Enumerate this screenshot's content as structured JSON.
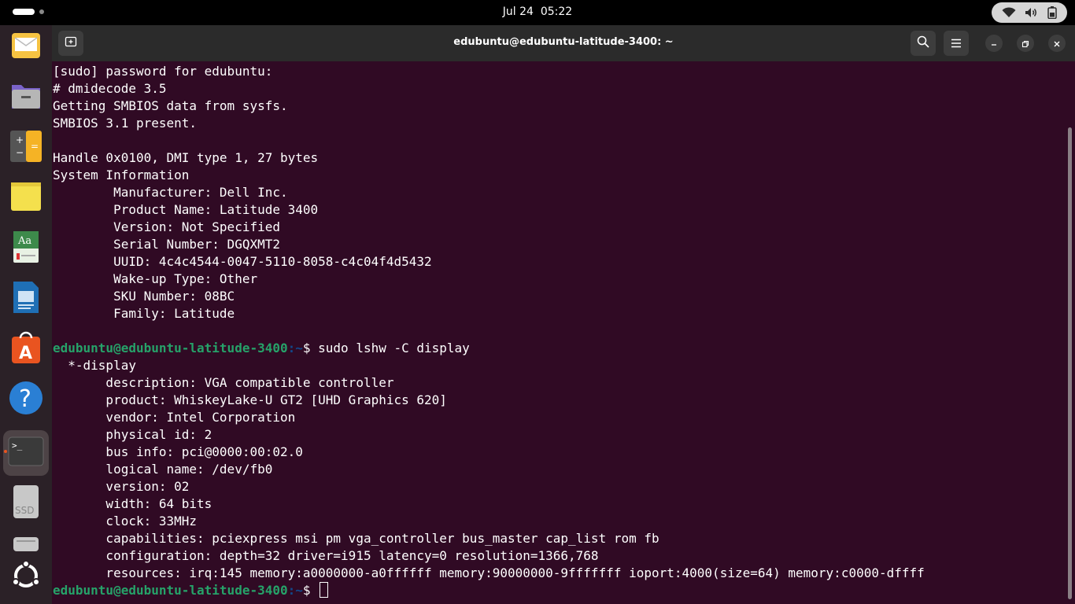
{
  "topbar": {
    "clock_date": "Jul 24",
    "clock_time": "05:22"
  },
  "systray": {
    "icons": [
      "wifi-icon",
      "volume-icon",
      "battery-icon"
    ]
  },
  "dock": {
    "items": [
      {
        "name": "mail-app",
        "icon": "envelope"
      },
      {
        "name": "files-app",
        "icon": "folder"
      },
      {
        "name": "calculator-app",
        "icon": "calculator"
      },
      {
        "name": "notes-app",
        "icon": "sticky-note"
      },
      {
        "name": "dictionary-app",
        "icon": "book-aa"
      },
      {
        "name": "writer-app",
        "icon": "document"
      },
      {
        "name": "app-center",
        "icon": "store-a"
      },
      {
        "name": "help-app",
        "icon": "question-mark"
      },
      {
        "name": "terminal-app",
        "icon": "terminal",
        "active": true
      },
      {
        "name": "ssd-drive",
        "icon": "drive",
        "label": "SSD"
      },
      {
        "name": "drive",
        "icon": "drive"
      },
      {
        "name": "show-apps",
        "icon": "ubuntu-logo"
      }
    ]
  },
  "window": {
    "title": "edubuntu@edubuntu-latitude-3400: ~"
  },
  "terminal": {
    "lines": [
      {
        "text": "[sudo] password for edubuntu:"
      },
      {
        "text": "# dmidecode 3.5"
      },
      {
        "text": "Getting SMBIOS data from sysfs."
      },
      {
        "text": "SMBIOS 3.1 present."
      },
      {
        "text": ""
      },
      {
        "text": "Handle 0x0100, DMI type 1, 27 bytes"
      },
      {
        "text": "System Information"
      },
      {
        "text": "        Manufacturer: Dell Inc."
      },
      {
        "text": "        Product Name: Latitude 3400"
      },
      {
        "text": "        Version: Not Specified"
      },
      {
        "text": "        Serial Number: DGQXMT2"
      },
      {
        "text": "        UUID: 4c4c4544-0047-5110-8058-c4c04f4d5432"
      },
      {
        "text": "        Wake-up Type: Other"
      },
      {
        "text": "        SKU Number: 08BC"
      },
      {
        "text": "        Family: Latitude"
      },
      {
        "text": ""
      },
      {
        "prompt": {
          "user": "edubuntu@edubuntu-latitude-3400",
          "path": ":~",
          "symbol": "$ "
        },
        "text": "sudo lshw -C display"
      },
      {
        "text": "  *-display"
      },
      {
        "text": "       description: VGA compatible controller"
      },
      {
        "text": "       product: WhiskeyLake-U GT2 [UHD Graphics 620]"
      },
      {
        "text": "       vendor: Intel Corporation"
      },
      {
        "text": "       physical id: 2"
      },
      {
        "text": "       bus info: pci@0000:00:02.0"
      },
      {
        "text": "       logical name: /dev/fb0"
      },
      {
        "text": "       version: 02"
      },
      {
        "text": "       width: 64 bits"
      },
      {
        "text": "       clock: 33MHz"
      },
      {
        "text": "       capabilities: pciexpress msi pm vga_controller bus_master cap_list rom fb"
      },
      {
        "text": "       configuration: depth=32 driver=i915 latency=0 resolution=1366,768"
      },
      {
        "text": "       resources: irq:145 memory:a0000000-a0ffffff memory:90000000-9fffffff ioport:4000(size=64) memory:c0000-dffff"
      },
      {
        "prompt": {
          "user": "edubuntu@edubuntu-latitude-3400",
          "path": ":~",
          "symbol": "$ "
        },
        "text": "",
        "cursor": true
      }
    ]
  },
  "colors": {
    "terminal_bg": "#300a24",
    "prompt_user": "#26a269",
    "prompt_path": "#12488b",
    "accent": "#e95420"
  }
}
